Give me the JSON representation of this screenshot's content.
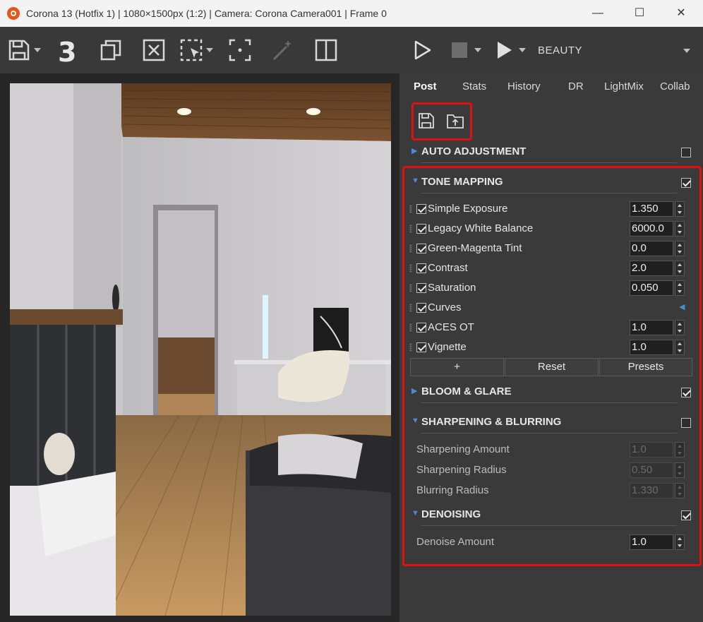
{
  "window": {
    "title": "Corona 13 (Hotfix 1) | 1080×1500px (1:2) | Camera: Corona Camera001 | Frame 0",
    "minimize": "—",
    "maximize": "☐",
    "close": "✕"
  },
  "toolbar": {
    "three_label": "3",
    "pass_label": "BEAUTY"
  },
  "tabs": [
    "Post",
    "Stats",
    "History",
    "DR",
    "LightMix",
    "Collab"
  ],
  "sections": {
    "auto_adjustment": {
      "label": "AUTO ADJUSTMENT",
      "checked": false
    },
    "tone_mapping": {
      "label": "TONE MAPPING",
      "checked": true
    },
    "bloom_glare": {
      "label": "BLOOM & GLARE",
      "checked": true
    },
    "sharpening": {
      "label": "SHARPENING & BLURRING",
      "checked": false
    },
    "denoising": {
      "label": "DENOISING",
      "checked": true
    }
  },
  "tone_ops": [
    {
      "label": "Simple Exposure",
      "value": "1.350",
      "checked": true
    },
    {
      "label": "Legacy White Balance",
      "value": "6000.0",
      "checked": true
    },
    {
      "label": "Green-Magenta Tint",
      "value": "0.0",
      "checked": true
    },
    {
      "label": "Contrast",
      "value": "2.0",
      "checked": true
    },
    {
      "label": "Saturation",
      "value": "0.050",
      "checked": true
    },
    {
      "label": "Curves",
      "value": "",
      "checked": true
    },
    {
      "label": "ACES OT",
      "value": "1.0",
      "checked": true
    },
    {
      "label": "Vignette",
      "value": "1.0",
      "checked": true
    }
  ],
  "buttons": {
    "add": "+",
    "reset": "Reset",
    "presets": "Presets"
  },
  "sharpening_rows": [
    {
      "label": "Sharpening Amount",
      "value": "1.0"
    },
    {
      "label": "Sharpening Radius",
      "value": "0.50"
    },
    {
      "label": "Blurring Radius",
      "value": "1.330"
    }
  ],
  "denoise": {
    "label": "Denoise Amount",
    "value": "1.0"
  },
  "colors": {
    "highlight": "#e01010",
    "accent": "#4a8ad8",
    "panel": "#3a3a3a"
  }
}
